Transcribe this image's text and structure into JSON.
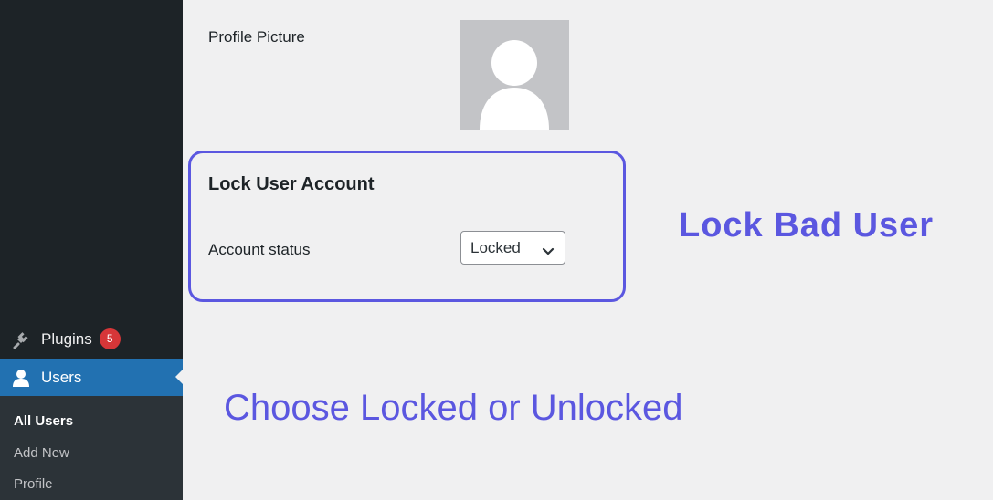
{
  "sidebar": {
    "items": [
      {
        "label": "Plugins",
        "icon": "plugin-icon",
        "badge": "5"
      },
      {
        "label": "Users",
        "icon": "user-icon",
        "active": true
      }
    ],
    "submenu": [
      {
        "label": "All Users",
        "current": true
      },
      {
        "label": "Add New"
      },
      {
        "label": "Profile"
      }
    ]
  },
  "profile": {
    "picture_label": "Profile Picture",
    "avatar_icon": "default-avatar-icon"
  },
  "lock_section": {
    "heading": "Lock User Account",
    "status_label": "Account status",
    "status_value": "Locked"
  },
  "annotations": {
    "title": "Lock Bad User",
    "caption": "Choose Locked or Unlocked"
  },
  "colors": {
    "sidebar_bg": "#1d2327",
    "submenu_bg": "#2c3338",
    "active_blue": "#2271b1",
    "badge_red": "#d63638",
    "annotation_purple": "#5b57e0",
    "page_bg": "#f0f0f1"
  }
}
